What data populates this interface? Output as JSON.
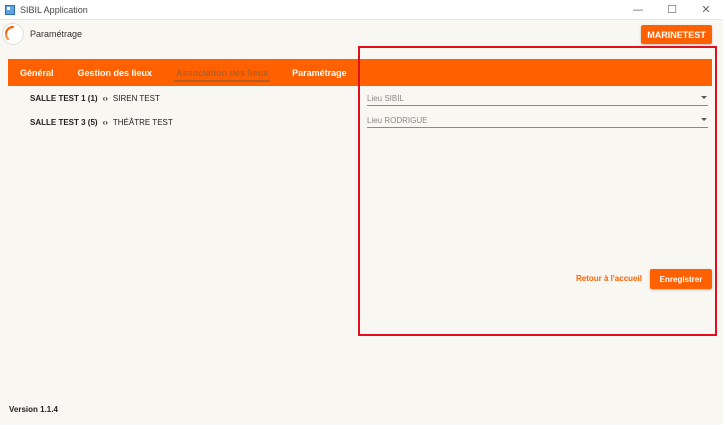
{
  "window": {
    "title": "SIBIL Application",
    "controls": {
      "minimize": "—",
      "maximize": "☐",
      "close": "✕"
    }
  },
  "header": {
    "page_title": "Paramétrage",
    "user_label": "MARINETEST"
  },
  "nav": {
    "tabs": [
      {
        "label": "Général",
        "active": false
      },
      {
        "label": "Gestion des lieux",
        "active": false
      },
      {
        "label": "Association des lieux",
        "active": true
      },
      {
        "label": "Paramétrage",
        "active": false
      }
    ]
  },
  "associations": [
    {
      "left": "SALLE TEST 1 (1)",
      "arrow": "‹›",
      "right": "SIREN TEST",
      "select_value": "Lieu SIBIL"
    },
    {
      "left": "SALLE TEST 3 (5)",
      "arrow": "‹›",
      "right": "THÉÂTRE TEST",
      "select_value": "Lieu RODRIGUE"
    }
  ],
  "actions": {
    "back_label": "Retour à l'accueil",
    "save_label": "Enregistrer"
  },
  "footer": {
    "version": "Version 1.1.4"
  },
  "colors": {
    "accent": "#ff6100",
    "highlight": "#e20f1f",
    "background": "#f8f7f2"
  },
  "icons": {
    "app": "app-window-icon",
    "logo": "loading-ring-icon",
    "dropdown": "chevron-down-icon"
  }
}
